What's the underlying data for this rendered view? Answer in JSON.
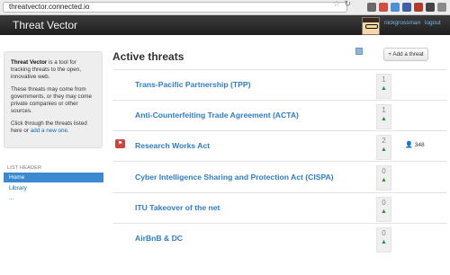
{
  "browser": {
    "url": "threatvector.connected.io"
  },
  "header": {
    "brand": "Threat Vector",
    "user": "nickgrossman",
    "logout": "logout"
  },
  "sidebar": {
    "intro_brand": "Threat Vector",
    "intro_line1": " is a tool for tracking threats to the open, innovative web.",
    "intro_p2": "These threats may come from governments, or they may come private companies or other sources.",
    "intro_p3_pre": "Click through the threats listed here or ",
    "intro_p3_link": "add a new one",
    "intro_p3_post": ".",
    "list_header": "LIST HEADER",
    "nav": [
      "Home",
      "Library",
      "..."
    ]
  },
  "main": {
    "title": "Active threats",
    "add_button": "+ Add a threat",
    "threats": [
      {
        "title": "Trans-Pacific Partnership (TPP)",
        "votes": "1"
      },
      {
        "title": "Anti-Counterfeiting Trade Agreement (ACTA)",
        "votes": "1"
      },
      {
        "title": "Research Works Act",
        "votes": "2",
        "watchers": "348"
      },
      {
        "title": "Cyber Intelligence Sharing and Protection Act (CISPA)",
        "votes": "0"
      },
      {
        "title": "ITU Takeover of the net",
        "votes": "0"
      },
      {
        "title": "AirBnB & DC",
        "votes": "0"
      }
    ]
  }
}
